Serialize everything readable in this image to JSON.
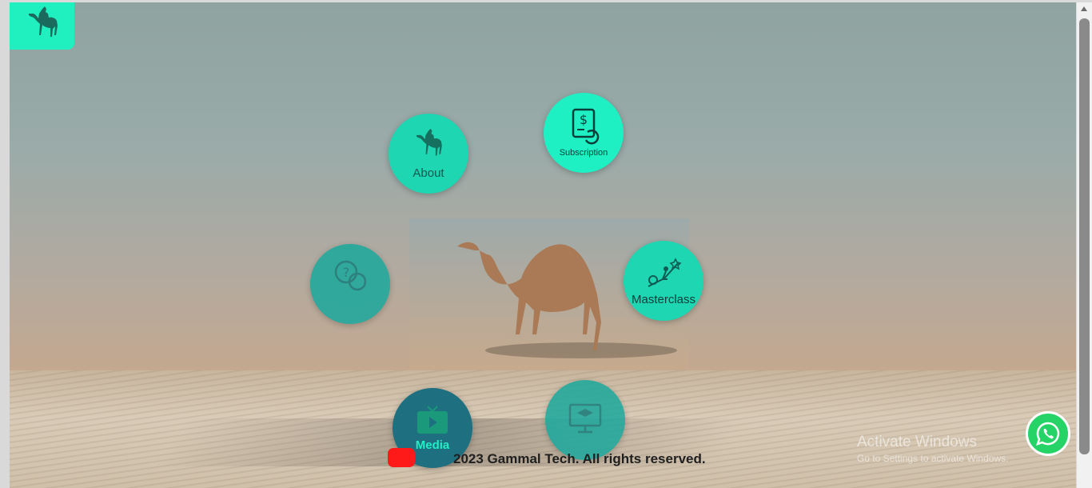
{
  "brand": {
    "logo_icon": "camel-icon",
    "accent": "#20f0c0"
  },
  "menu": {
    "about": "About",
    "subscription": "Subscription",
    "help": "Help",
    "masterclass": "Masterclass",
    "media": "Media",
    "courses": ""
  },
  "footer": {
    "copyright": "2023 Gammal Tech. All rights reserved."
  },
  "overlay": {
    "activate_title": "Activate Windows",
    "activate_sub": "Go to Settings to activate Windows."
  }
}
